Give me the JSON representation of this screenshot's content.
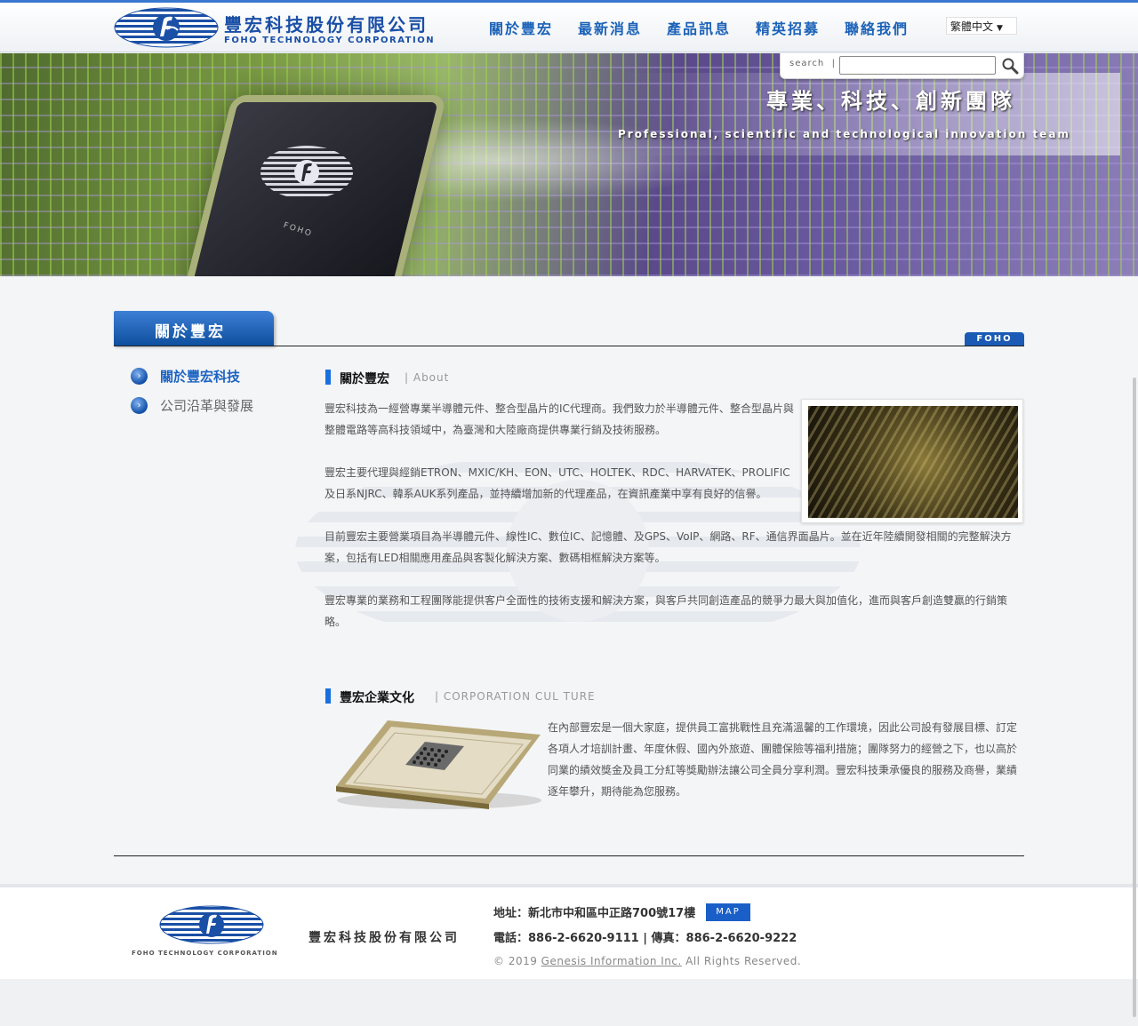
{
  "header": {
    "company_cn": "豐宏科技股份有限公司",
    "company_en": "FOHO TECHNOLOGY CORPORATION",
    "nav": [
      {
        "label": "關於豐宏"
      },
      {
        "label": "最新消息"
      },
      {
        "label": "產品訊息"
      },
      {
        "label": "精英招募"
      },
      {
        "label": "聯絡我們"
      }
    ],
    "language": "繁體中文"
  },
  "search": {
    "label": "search",
    "value": ""
  },
  "banner": {
    "slogan_cn": "專業、科技、創新團隊",
    "slogan_en": "Professional, scientific and technological innovation team",
    "chip_text": "FOHO"
  },
  "section": {
    "tab_title": "關於豐宏",
    "brand_tag": "FOHO"
  },
  "sidebar": {
    "items": [
      {
        "label": "關於豐宏科技",
        "active": true
      },
      {
        "label": "公司沿革與發展",
        "active": false
      }
    ]
  },
  "about": {
    "title": "關於豐宏",
    "subtitle": "| About",
    "paragraphs": [
      "豐宏科技為一經營專業半導體元件、整合型晶片的IC代理商。我們致力於半導體元件、整合型晶片與整體電路等高科技領域中，為臺灣和大陸廠商提供專業行銷及技術服務。",
      "豐宏主要代理與經銷ETRON、MXIC/KH、EON、UTC、HOLTEK、RDC、HARVATEK、PROLIFIC及日系NJRC、韓系AUK系列產品，並持續增加新的代理產品，在資訊產業中享有良好的信譽。",
      "目前豐宏主要營業項目為半導體元件、線性IC、數位IC、記憶體、及GPS、VoIP、網路、RF、通信界面晶片。並在近年陸續開發相關的完整解決方案，包括有LED相關應用產品與客製化解決方案、數碼相框解決方案等。",
      "豐宏專業的業務和工程團隊能提供客户全面性的技術支援和解決方案，與客戶共同創造產品的競爭力最大與加值化，進而與客戶創造雙贏的行銷策略。"
    ]
  },
  "culture": {
    "title": "豐宏企業文化",
    "subtitle": "| CORPORATION CUL TURE",
    "paragraph": "在內部豐宏是一個大家庭，提供員工富挑戰性且充滿溫馨的工作環境，因此公司設有發展目標、訂定各項人才培訓計畫、年度休假、國內外旅遊、團體保險等福利措施；團隊努力的經營之下，也以高於同業的績效獎金及員工分紅等獎勵辦法讓公司全員分享利潤。豐宏科技秉承優良的服務及商譽，業績逐年攀升，期待能為您服務。"
  },
  "footer": {
    "company_cn": "豐宏科技股份有限公司",
    "company_en": "FOHO TECHNOLOGY CORPORATION",
    "address": "地址：新北市中和區中正路700號17樓",
    "map_label": "MAP",
    "phone": "電話：886-2-6620-9111 | 傳真：886-2-6620-9222",
    "copyright_prefix": "© 2019 ",
    "copyright_link": "Genesis Information Inc.",
    "copyright_suffix": " All Rights Reserved."
  }
}
